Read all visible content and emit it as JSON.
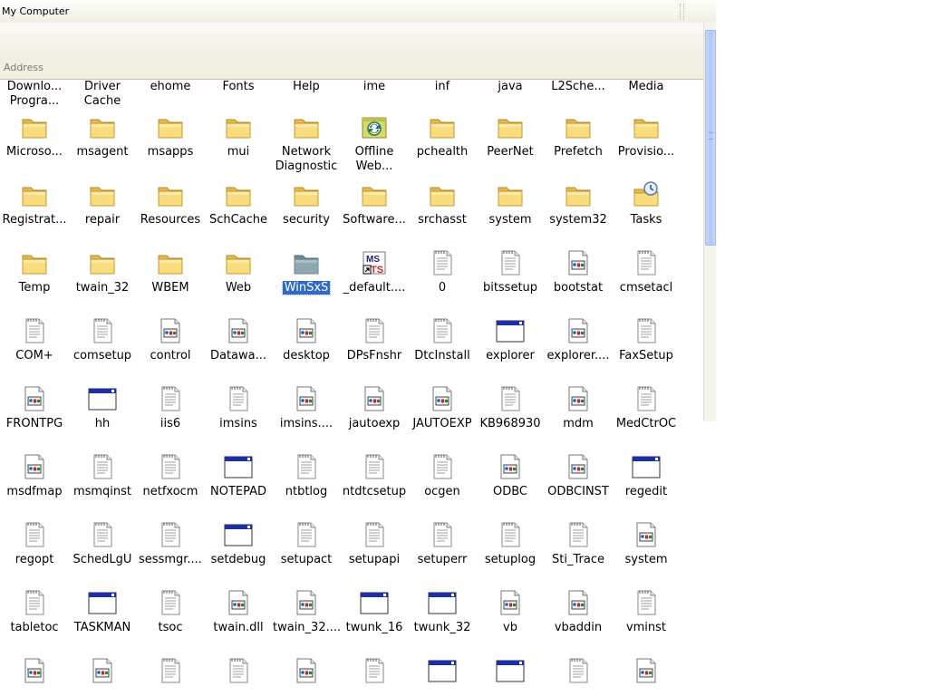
{
  "window": {
    "title": "My Computer",
    "address_label": "Address"
  },
  "items": [
    {
      "label": "Downlo...\nProgra...",
      "icon": "none"
    },
    {
      "label": "Driver\nCache",
      "icon": "none"
    },
    {
      "label": "ehome",
      "icon": "none"
    },
    {
      "label": "Fonts",
      "icon": "none"
    },
    {
      "label": "Help",
      "icon": "none"
    },
    {
      "label": "ime",
      "icon": "none"
    },
    {
      "label": "inf",
      "icon": "none"
    },
    {
      "label": "java",
      "icon": "none"
    },
    {
      "label": "L2Sche...",
      "icon": "none"
    },
    {
      "label": "Media",
      "icon": "none"
    },
    {
      "label": "Microso...",
      "icon": "folder"
    },
    {
      "label": "msagent",
      "icon": "folder"
    },
    {
      "label": "msapps",
      "icon": "folder"
    },
    {
      "label": "mui",
      "icon": "folder"
    },
    {
      "label": "Network\nDiagnostic",
      "icon": "folder"
    },
    {
      "label": "Offline\nWeb...",
      "icon": "offline-folder"
    },
    {
      "label": "pchealth",
      "icon": "folder"
    },
    {
      "label": "PeerNet",
      "icon": "folder"
    },
    {
      "label": "Prefetch",
      "icon": "folder"
    },
    {
      "label": "Provisio...",
      "icon": "folder"
    },
    {
      "label": "Registrat...",
      "icon": "folder"
    },
    {
      "label": "repair",
      "icon": "folder"
    },
    {
      "label": "Resources",
      "icon": "folder"
    },
    {
      "label": "SchCache",
      "icon": "folder"
    },
    {
      "label": "security",
      "icon": "folder"
    },
    {
      "label": "Software...",
      "icon": "folder"
    },
    {
      "label": "srchasst",
      "icon": "folder"
    },
    {
      "label": "system",
      "icon": "folder"
    },
    {
      "label": "system32",
      "icon": "folder"
    },
    {
      "label": "Tasks",
      "icon": "tasks-folder"
    },
    {
      "label": "Temp",
      "icon": "folder"
    },
    {
      "label": "twain_32",
      "icon": "folder"
    },
    {
      "label": "WBEM",
      "icon": "folder"
    },
    {
      "label": "Web",
      "icon": "folder"
    },
    {
      "label": "WinSxS",
      "icon": "folder-selected",
      "selected": true
    },
    {
      "label": "_default....",
      "icon": "msts-shortcut"
    },
    {
      "label": "0",
      "icon": "text-file"
    },
    {
      "label": "bitssetup",
      "icon": "text-file"
    },
    {
      "label": "bootstat",
      "icon": "dat-file"
    },
    {
      "label": "cmsetacl",
      "icon": "text-file"
    },
    {
      "label": "COM+",
      "icon": "text-file"
    },
    {
      "label": "comsetup",
      "icon": "text-file"
    },
    {
      "label": "control",
      "icon": "dat-file"
    },
    {
      "label": "Datawa...",
      "icon": "dat-file"
    },
    {
      "label": "desktop",
      "icon": "dat-file"
    },
    {
      "label": "DPsFnshr",
      "icon": "text-file"
    },
    {
      "label": "DtcInstall",
      "icon": "text-file"
    },
    {
      "label": "explorer",
      "icon": "app-window"
    },
    {
      "label": "explorer....",
      "icon": "dat-file"
    },
    {
      "label": "FaxSetup",
      "icon": "text-file"
    },
    {
      "label": "FRONTPG",
      "icon": "dat-file"
    },
    {
      "label": "hh",
      "icon": "app-window"
    },
    {
      "label": "iis6",
      "icon": "text-file"
    },
    {
      "label": "imsins",
      "icon": "text-file"
    },
    {
      "label": "imsins....",
      "icon": "dat-file"
    },
    {
      "label": "jautoexp",
      "icon": "dat-file"
    },
    {
      "label": "JAUTOEXP",
      "icon": "dat-file"
    },
    {
      "label": "KB968930",
      "icon": "text-file"
    },
    {
      "label": "mdm",
      "icon": "dat-file"
    },
    {
      "label": "MedCtrOC",
      "icon": "text-file"
    },
    {
      "label": "msdfmap",
      "icon": "dat-file"
    },
    {
      "label": "msmqinst",
      "icon": "text-file"
    },
    {
      "label": "netfxocm",
      "icon": "text-file"
    },
    {
      "label": "NOTEPAD",
      "icon": "app-window"
    },
    {
      "label": "ntbtlog",
      "icon": "text-file"
    },
    {
      "label": "ntdtcsetup",
      "icon": "text-file"
    },
    {
      "label": "ocgen",
      "icon": "text-file"
    },
    {
      "label": "ODBC",
      "icon": "dat-file"
    },
    {
      "label": "ODBCINST",
      "icon": "dat-file"
    },
    {
      "label": "regedit",
      "icon": "app-window"
    },
    {
      "label": "regopt",
      "icon": "text-file"
    },
    {
      "label": "SchedLgU",
      "icon": "text-file"
    },
    {
      "label": "sessmgr....",
      "icon": "text-file"
    },
    {
      "label": "setdebug",
      "icon": "app-window"
    },
    {
      "label": "setupact",
      "icon": "text-file"
    },
    {
      "label": "setupapi",
      "icon": "text-file"
    },
    {
      "label": "setuperr",
      "icon": "text-file"
    },
    {
      "label": "setuplog",
      "icon": "text-file"
    },
    {
      "label": "Sti_Trace",
      "icon": "text-file"
    },
    {
      "label": "system",
      "icon": "dat-file"
    },
    {
      "label": "tabletoc",
      "icon": "text-file"
    },
    {
      "label": "TASKMAN",
      "icon": "app-window"
    },
    {
      "label": "tsoc",
      "icon": "text-file"
    },
    {
      "label": "twain.dll",
      "icon": "dat-file"
    },
    {
      "label": "twain_32....",
      "icon": "dat-file"
    },
    {
      "label": "twunk_16",
      "icon": "app-window"
    },
    {
      "label": "twunk_32",
      "icon": "app-window"
    },
    {
      "label": "vb",
      "icon": "dat-file"
    },
    {
      "label": "vbaddin",
      "icon": "dat-file"
    },
    {
      "label": "vminst",
      "icon": "text-file"
    },
    {
      "label": "",
      "icon": "dat-file"
    },
    {
      "label": "",
      "icon": "dat-file"
    },
    {
      "label": "",
      "icon": "text-file"
    },
    {
      "label": "",
      "icon": "text-file"
    },
    {
      "label": "",
      "icon": "dat-file"
    },
    {
      "label": "",
      "icon": "text-file"
    },
    {
      "label": "",
      "icon": "app-window"
    },
    {
      "label": "",
      "icon": "app-window"
    },
    {
      "label": "",
      "icon": "text-file"
    },
    {
      "label": "",
      "icon": "dat-file"
    }
  ],
  "colors": {
    "selection": "#316ac5",
    "folder": "#f7d774",
    "window_frame": "#0a246a"
  }
}
